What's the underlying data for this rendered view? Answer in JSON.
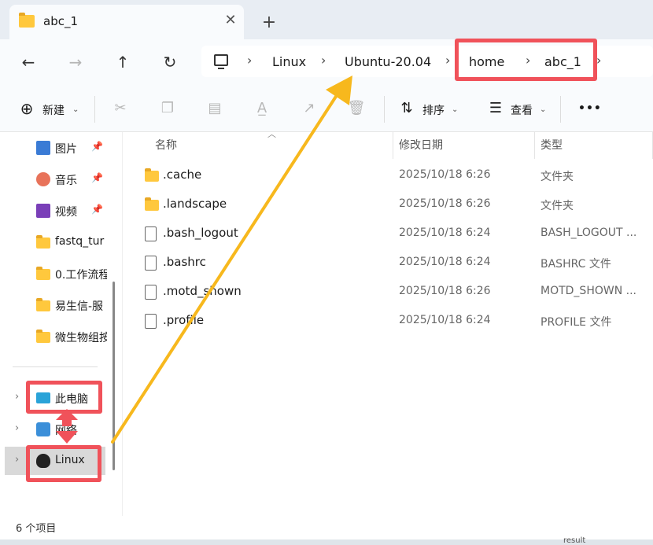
{
  "tab": {
    "title": "abc_1",
    "close_glyph": "✕",
    "new_glyph": "+"
  },
  "nav": {
    "back": "←",
    "forward": "→",
    "up": "↑",
    "refresh": "↻"
  },
  "breadcrumb": {
    "items": [
      "Linux",
      "Ubuntu-20.04",
      "home",
      "abc_1"
    ],
    "separator": "›"
  },
  "toolbar": {
    "new_label": "新建",
    "sort_label": "排序",
    "view_label": "查看",
    "more_label": "•••",
    "icons": [
      "cut-icon",
      "copy-icon",
      "paste-icon",
      "rename-icon",
      "share-icon",
      "delete-icon"
    ]
  },
  "sidebar": {
    "quick": [
      {
        "label": "图片",
        "icon": "pictures-icon",
        "pinned": true
      },
      {
        "label": "音乐",
        "icon": "music-icon",
        "pinned": true
      },
      {
        "label": "视频",
        "icon": "videos-icon",
        "pinned": true
      },
      {
        "label": "fastq_tur",
        "icon": "folder-icon",
        "pinned": false
      },
      {
        "label": "0.工作流程",
        "icon": "folder-icon",
        "pinned": false
      },
      {
        "label": "易生信-服",
        "icon": "folder-icon",
        "pinned": false
      },
      {
        "label": "微生物组按",
        "icon": "folder-icon",
        "pinned": false
      }
    ],
    "roots": [
      {
        "label": "此电脑",
        "icon": "this-pc-icon"
      },
      {
        "label": "网络",
        "icon": "network-icon"
      },
      {
        "label": "Linux",
        "icon": "linux-penguin-icon"
      }
    ]
  },
  "columns": {
    "name": "名称",
    "date": "修改日期",
    "type": "类型"
  },
  "files": [
    {
      "name": ".cache",
      "date": "2025/10/18 6:26",
      "type": "文件夹",
      "kind": "folder"
    },
    {
      "name": ".landscape",
      "date": "2025/10/18 6:26",
      "type": "文件夹",
      "kind": "folder"
    },
    {
      "name": ".bash_logout",
      "date": "2025/10/18 6:24",
      "type": "BASH_LOGOUT ...",
      "kind": "file"
    },
    {
      "name": ".bashrc",
      "date": "2025/10/18 6:24",
      "type": "BASHRC 文件",
      "kind": "file"
    },
    {
      "name": ".motd_shown",
      "date": "2025/10/18 6:26",
      "type": "MOTD_SHOWN ...",
      "kind": "file"
    },
    {
      "name": ".profile",
      "date": "2025/10/18 6:24",
      "type": "PROFILE 文件",
      "kind": "file"
    }
  ],
  "status": {
    "count": "6 个项目"
  },
  "background": {
    "peek_text": "result"
  },
  "colors": {
    "highlight": "#f0525a",
    "arrow_yellow": "#f7b81d",
    "arrow_red": "#f0525a",
    "folder": "#ffc83d"
  }
}
